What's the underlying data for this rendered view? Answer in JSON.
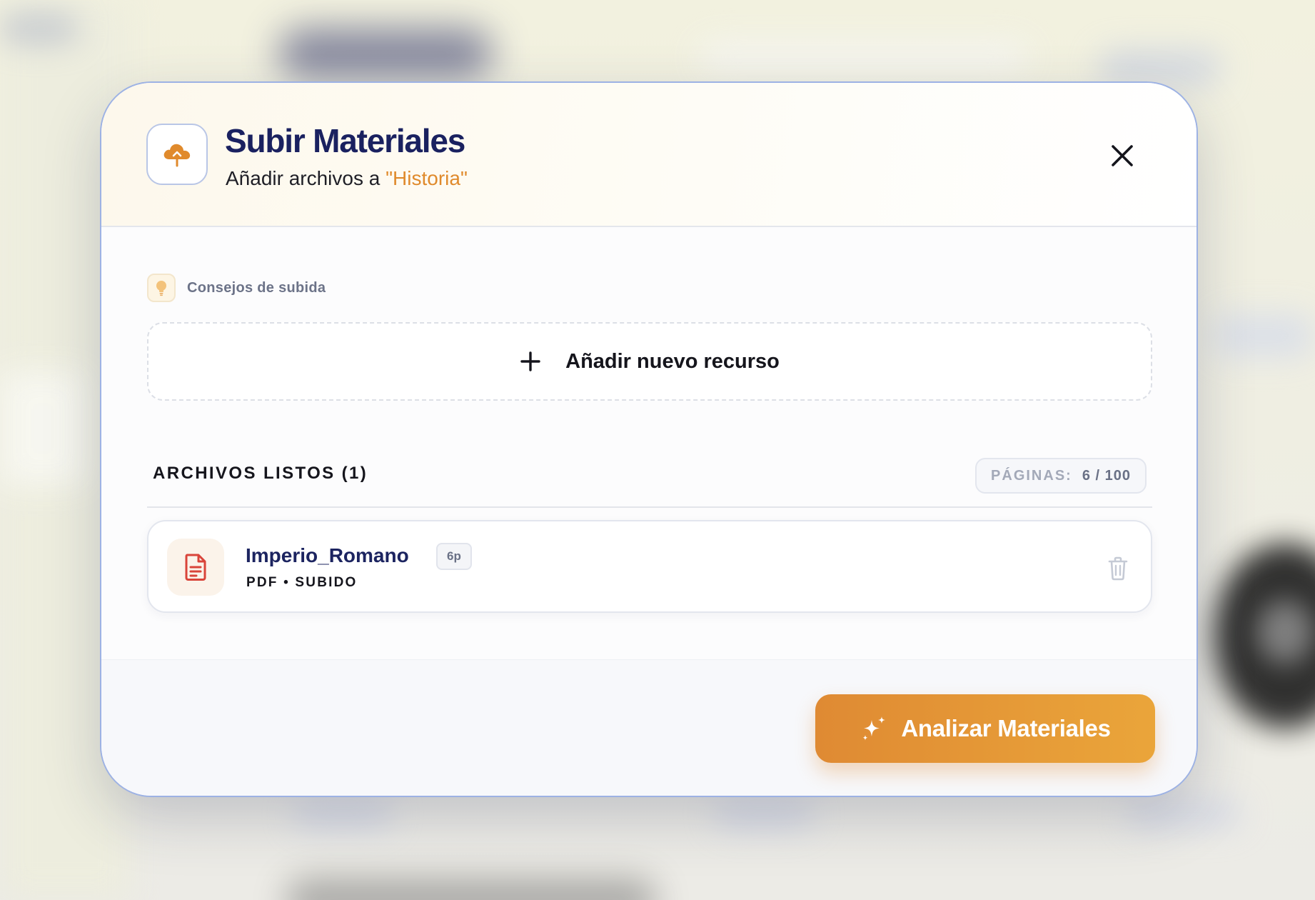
{
  "modal": {
    "title": "Subir Materiales",
    "subtitle_prefix": "Añadir archivos a ",
    "subject": "\"Historia\"",
    "header_icon": "cloud-upload-icon",
    "close_icon": "close-icon"
  },
  "tips": {
    "icon": "lightbulb-icon",
    "label": "Consejos de subida"
  },
  "add_resource": {
    "icon": "plus-icon",
    "label": "Añadir nuevo recurso"
  },
  "files": {
    "title": "ARCHIVOS LISTOS (1)",
    "pages_label": "PÁGINAS:",
    "pages_value": "6 / 100",
    "items": [
      {
        "icon": "pdf-file-icon",
        "name": "Imperio_Romano",
        "pages": "6p",
        "meta": "PDF • SUBIDO",
        "delete_icon": "trash-icon"
      }
    ]
  },
  "footer": {
    "analyze_icon": "sparkle-icon",
    "analyze_label": "Analizar Materiales"
  },
  "colors": {
    "accent": "#e08a2c",
    "title": "#1a2160",
    "button_start": "#df8a33",
    "button_end": "#eaa53a",
    "file_icon": "#d9443a",
    "modal_border": "#9db2e4"
  }
}
